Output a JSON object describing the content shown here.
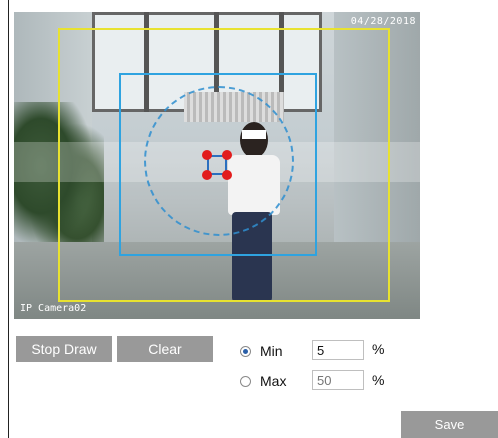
{
  "video": {
    "timestamp": "04/28/2018",
    "camera_name": "IP Camera02"
  },
  "controls": {
    "stop_draw_label": "Stop Draw",
    "clear_label": "Clear",
    "save_label": "Save"
  },
  "size_filter": {
    "min_label": "Min",
    "min_value": "5",
    "max_label": "Max",
    "max_placeholder": "50",
    "unit": "%",
    "selected": "Min"
  },
  "colors": {
    "outer_region": "#e8e230",
    "inner_region": "#2fa3e0",
    "handle": "#e21c1c",
    "button": "#999999"
  }
}
